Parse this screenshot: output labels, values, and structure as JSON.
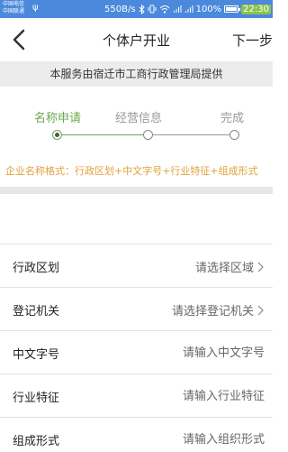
{
  "status": {
    "carrier_1": "中国电信",
    "carrier_2": "中国联通",
    "net_speed": "550B/s",
    "battery": "100%",
    "time": "22:30"
  },
  "header": {
    "title": "个体户开业",
    "next_label": "下一步"
  },
  "notice": "本服务由宿迁市工商行政管理局提供",
  "steps": [
    "名称申请",
    "经营信息",
    "完成"
  ],
  "format_hint": "企业名称格式：行政区划+中文字号+行业特征+组成形式",
  "form": {
    "region": {
      "label": "行政区划",
      "value": "请选择区域"
    },
    "authority": {
      "label": "登记机关",
      "value": "请选择登记机关"
    },
    "name": {
      "label": "中文字号",
      "placeholder": "请输入中文字号"
    },
    "industry": {
      "label": "行业特征",
      "placeholder": "请输入行业特征"
    },
    "form_type": {
      "label": "组成形式",
      "placeholder": "请输入组织形式"
    }
  },
  "colors": {
    "accent": "#6aa84f",
    "hint": "#e0a13a",
    "statusbar": "#4b89dc"
  }
}
